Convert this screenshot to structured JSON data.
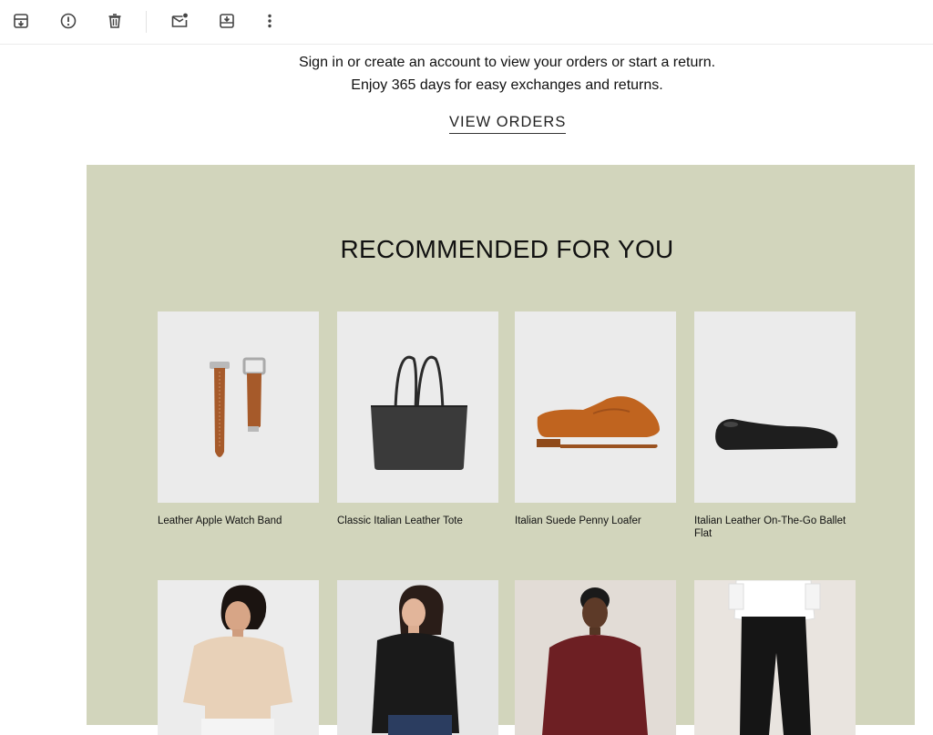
{
  "toolbar": {
    "buttons": [
      {
        "icon": "archive-icon"
      },
      {
        "icon": "report-spam-icon"
      },
      {
        "icon": "delete-icon"
      },
      {
        "icon": "mark-unread-icon"
      },
      {
        "icon": "move-to-icon"
      },
      {
        "icon": "more-options-icon"
      }
    ]
  },
  "message": {
    "line1": "Sign in or create an account to view your orders or start a return.",
    "line2": "Enjoy 365 days for easy exchanges and returns.",
    "cta": "VIEW ORDERS"
  },
  "recommended": {
    "title": "RECOMMENDED FOR YOU",
    "panel_color": "#d2d5bc",
    "products": [
      {
        "name": "Leather Apple Watch Band"
      },
      {
        "name": "Classic Italian Leather Tote"
      },
      {
        "name": "Italian Suede Penny Loafer"
      },
      {
        "name": "Italian Leather On-The-Go Ballet Flat"
      }
    ]
  }
}
